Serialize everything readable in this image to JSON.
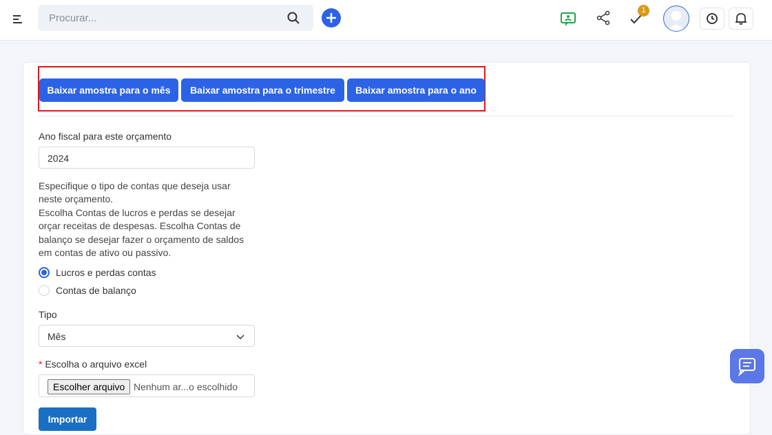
{
  "header": {
    "search_placeholder": "Procurar...",
    "notification_badge": "1"
  },
  "download_buttons": {
    "month": "Baixar amostra para o mês",
    "quarter": "Baixar amostra para o trimestre",
    "year": "Baixar amostra para o ano"
  },
  "form": {
    "fiscal_year_label": "Ano fiscal para este orçamento",
    "fiscal_year_value": "2024",
    "description_lines": [
      "Especifique o tipo de contas que deseja usar",
      "neste orçamento.",
      "Escolha Contas de lucros e perdas se desejar",
      "orçar receitas de despesas. Escolha Contas de",
      "balanço se desejar fazer o orçamento de saldos",
      "em contas de ativo ou passivo."
    ],
    "radio_profit_loss": "Lucros e perdas contas",
    "radio_balance": "Contas de balanço",
    "type_label": "Tipo",
    "type_value": "Mês",
    "file_required_mark": "*",
    "file_label": "Escolha o arquivo excel",
    "file_choose_button": "Escolher arquivo",
    "file_status": "Nenhum ar...o escolhido",
    "import_button": "Importar"
  },
  "colors": {
    "primary": "#2c63e6",
    "highlight_border": "#e0161b",
    "import_button": "#1a6fc4",
    "badge": "#d99a1a",
    "chat_button": "#5b77e8"
  },
  "icons": [
    "menu-icon",
    "search-icon",
    "plus-icon",
    "chat-presentation-icon",
    "share-icon",
    "check-icon",
    "user-avatar-icon",
    "clock-icon",
    "bell-icon",
    "chevron-down-icon",
    "message-icon"
  ]
}
